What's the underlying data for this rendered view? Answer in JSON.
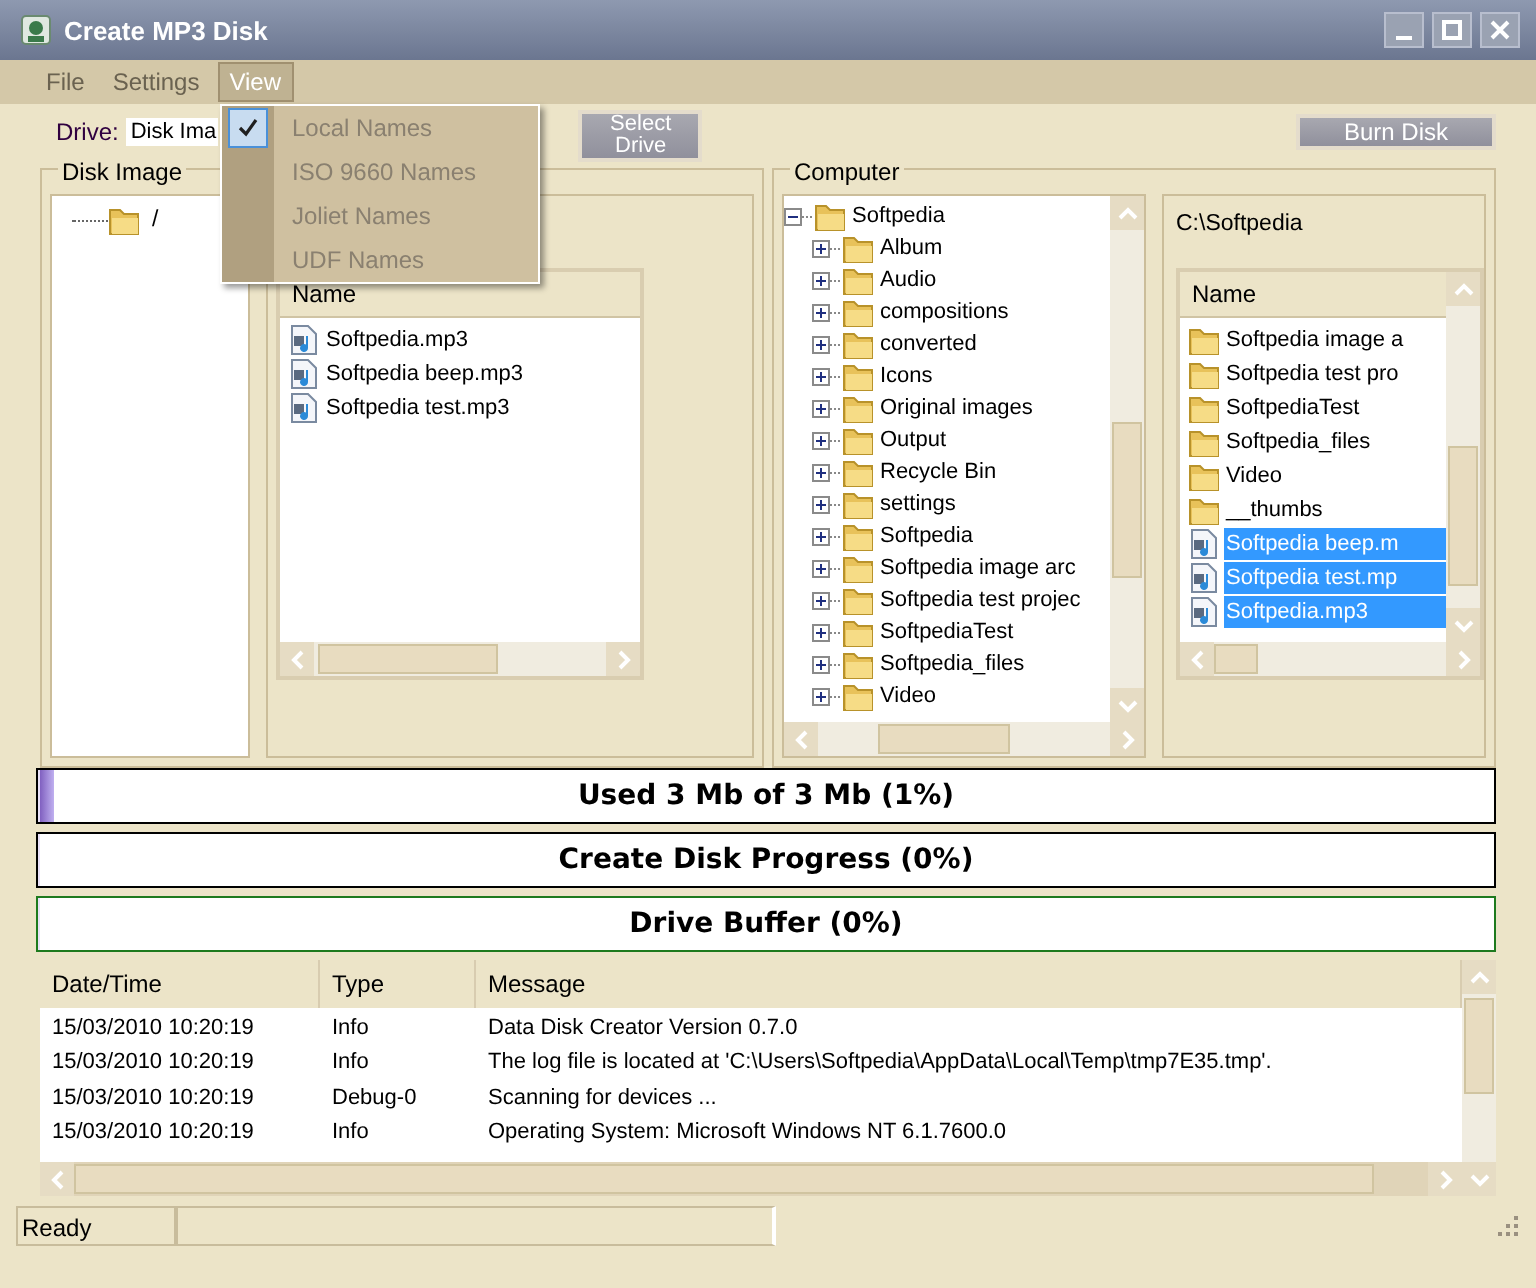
{
  "window": {
    "title": "Create MP3 Disk"
  },
  "menu": [
    {
      "label": "File",
      "selected": false
    },
    {
      "label": "Settings",
      "selected": false
    },
    {
      "label": "View",
      "selected": true
    }
  ],
  "view_menu": [
    {
      "label": "Local Names",
      "checked": true,
      "disabled": true
    },
    {
      "label": "ISO 9660 Names",
      "checked": false,
      "disabled": true
    },
    {
      "label": "Joliet Names",
      "checked": false,
      "disabled": true
    },
    {
      "label": "UDF Names",
      "checked": false,
      "disabled": true
    }
  ],
  "toolbar": {
    "drive_label": "Drive:",
    "drive_value": "Disk Ima",
    "select_button": "Select Drive",
    "burn_button": "Burn Disk"
  },
  "disk_image": {
    "title": "Disk Image",
    "tree": [
      {
        "label": "/",
        "kind": "folder"
      }
    ],
    "list": {
      "columns": [
        "Name"
      ],
      "rows": [
        {
          "name": "Softpedia.mp3",
          "kind": "audio",
          "selected": false
        },
        {
          "name": "Softpedia beep.mp3",
          "kind": "audio",
          "selected": false
        },
        {
          "name": "Softpedia test.mp3",
          "kind": "audio",
          "selected": false
        }
      ]
    }
  },
  "computer": {
    "title": "Computer",
    "tree": [
      {
        "label": "Softpedia",
        "expanded": true,
        "children": [
          {
            "label": "Album",
            "expanded": false
          },
          {
            "label": "Audio",
            "expanded": false
          },
          {
            "label": "compositions",
            "expanded": false
          },
          {
            "label": "converted",
            "expanded": false
          },
          {
            "label": "Icons",
            "expanded": false
          },
          {
            "label": "Original images",
            "expanded": false
          },
          {
            "label": "Output",
            "expanded": false
          },
          {
            "label": "Recycle Bin",
            "expanded": false
          },
          {
            "label": "settings",
            "expanded": false
          },
          {
            "label": "Softpedia",
            "expanded": false
          },
          {
            "label": "Softpedia image arc",
            "expanded": false
          },
          {
            "label": "Softpedia test projec",
            "expanded": false
          },
          {
            "label": "SoftpediaTest",
            "expanded": false
          },
          {
            "label": "Softpedia_files",
            "expanded": false
          },
          {
            "label": "Video",
            "expanded": false
          }
        ]
      }
    ],
    "path": "C:\\Softpedia",
    "list": {
      "columns": [
        "Name"
      ],
      "rows": [
        {
          "name": "Softpedia image a",
          "kind": "folder",
          "selected": false
        },
        {
          "name": "Softpedia test pro",
          "kind": "folder",
          "selected": false
        },
        {
          "name": "SoftpediaTest",
          "kind": "folder",
          "selected": false
        },
        {
          "name": "Softpedia_files",
          "kind": "folder",
          "selected": false
        },
        {
          "name": "Video",
          "kind": "folder",
          "selected": false
        },
        {
          "name": "__thumbs",
          "kind": "folder",
          "selected": false
        },
        {
          "name": "Softpedia beep.m",
          "kind": "audio",
          "selected": true
        },
        {
          "name": "Softpedia test.mp",
          "kind": "audio",
          "selected": true
        },
        {
          "name": "Softpedia.mp3",
          "kind": "audio",
          "selected": true
        }
      ]
    }
  },
  "progress": [
    {
      "label": "Used 3 Mb of 3 Mb (1%)",
      "level": 0.01,
      "color": "#000000"
    },
    {
      "label": "Create Disk Progress (0%)",
      "level": 0,
      "color": "#000000"
    },
    {
      "label": "Drive Buffer (0%)",
      "level": 0,
      "color": "#1e7a1e"
    }
  ],
  "log": {
    "columns": [
      "Date/Time",
      "Type",
      "Message"
    ],
    "rows": [
      [
        "15/03/2010 10:20:19",
        "Info",
        "Data Disk Creator Version 0.7.0"
      ],
      [
        "15/03/2010 10:20:19",
        "Info",
        "The log file is located at 'C:\\Users\\Softpedia\\AppData\\Local\\Temp\\tmp7E35.tmp'."
      ],
      [
        "15/03/2010 10:20:19",
        "Debug-0",
        "Scanning for devices ..."
      ],
      [
        "15/03/2010 10:20:19",
        "Info",
        "Operating System: Microsoft Windows NT 6.1.7600.0"
      ]
    ]
  },
  "status_bar": {
    "text": "Ready"
  }
}
